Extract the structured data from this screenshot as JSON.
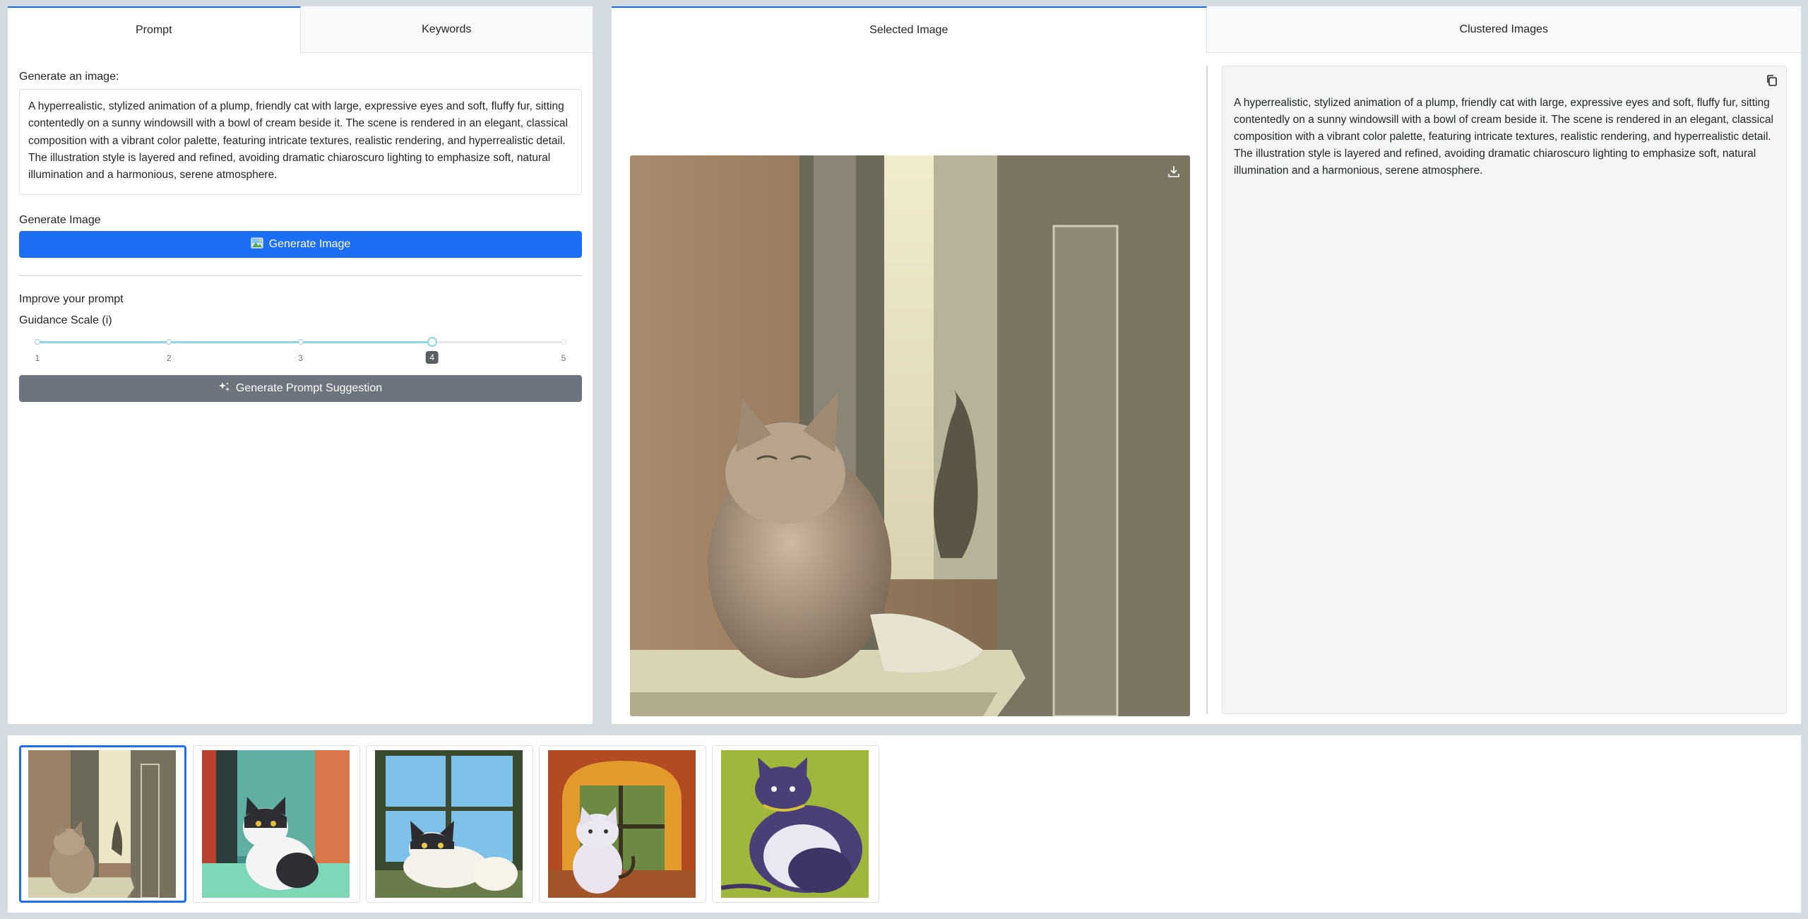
{
  "left_tabs": [
    {
      "label": "Prompt",
      "active": true
    },
    {
      "label": "Keywords",
      "active": false
    }
  ],
  "generate_label": "Generate an image:",
  "prompt_text": "A hyperrealistic, stylized animation of a plump, friendly cat with large, expressive eyes and soft, fluffy fur, sitting contentedly on a sunny windowsill with a bowl of cream beside it. The scene is rendered in an elegant, classical composition with a vibrant color palette, featuring intricate textures, realistic rendering, and hyperrealistic detail. The illustration style is layered and refined, avoiding dramatic chiaroscuro lighting to emphasize soft, natural illumination and a harmonious, serene atmosphere.",
  "generate_image_section": "Generate Image",
  "generate_image_button": "Generate Image",
  "improve_label": "Improve your prompt",
  "guidance_label": "Guidance Scale (i)",
  "guidance": {
    "marks": [
      "1",
      "2",
      "3",
      "4",
      "5"
    ],
    "value": 4,
    "min": 1,
    "max": 5
  },
  "suggestion_button": "Generate Prompt Suggestion",
  "right_tabs": [
    {
      "label": "Selected Image",
      "active": true
    },
    {
      "label": "Clustered Images",
      "active": false
    }
  ],
  "selected_description": "A hyperrealistic, stylized animation of a plump, friendly cat with large, expressive eyes and soft, fluffy fur, sitting contentedly on a sunny windowsill with a bowl of cream beside it. The scene is rendered in an elegant, classical composition with a vibrant color palette, featuring intricate textures, realistic rendering, and hyperrealistic detail. The illustration style is layered and refined, avoiding dramatic chiaroscuro lighting to emphasize soft, natural illumination and a harmonious, serene atmosphere.",
  "icons": {
    "download": "download-icon",
    "copy": "copy-icon",
    "image": "image-icon",
    "sparkle": "magic-sparkle-icon"
  },
  "colors": {
    "primary": "#1c6ef2",
    "secondary": "#6c757d",
    "slider": "#8ed6e5"
  },
  "gallery": [
    {
      "name": "thumb-beige-cat-window",
      "selected": true
    },
    {
      "name": "thumb-tuxedo-cat-teal",
      "selected": false
    },
    {
      "name": "thumb-fluffy-cat-blue-window",
      "selected": false
    },
    {
      "name": "thumb-white-cat-orange-window",
      "selected": false
    },
    {
      "name": "thumb-purple-cat-green",
      "selected": false
    }
  ]
}
